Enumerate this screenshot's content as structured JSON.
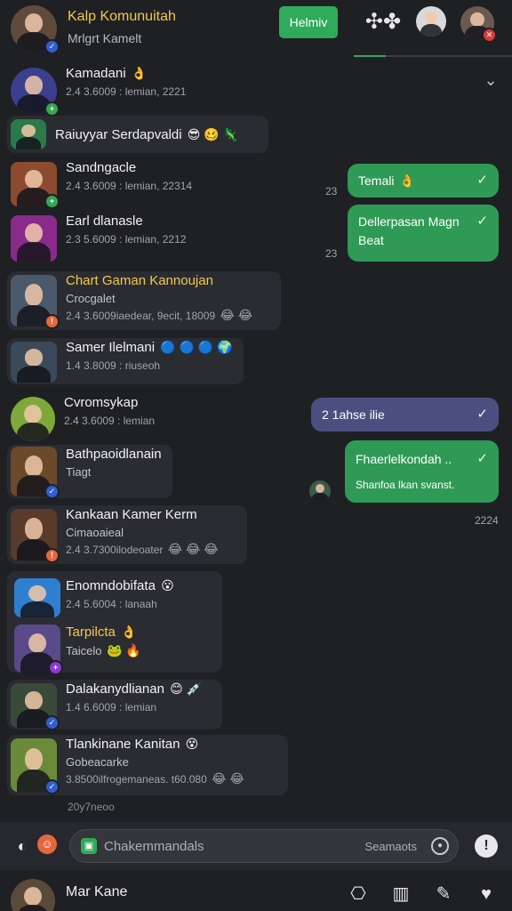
{
  "header": {
    "title": "Kalp Komunuitah",
    "subtitle": "Mrlgrt Kamelt",
    "follow_label": "Helmiv"
  },
  "chats": [
    {
      "name": "Kamadani",
      "emoji": "👌",
      "meta": "2.4 3.6009 : lemian, 2221"
    },
    {
      "name": "Raiuyyar Serdapvaldi",
      "emoji": "😎 🥴 🦎",
      "meta": ""
    },
    {
      "name": "Sandngacle",
      "emoji": "",
      "meta": "2.4 3.6009 : lemian, 22314"
    },
    {
      "name": "Earl dlanasle",
      "emoji": "",
      "meta": "2.3 5.6009 : lemian, 2212"
    },
    {
      "name": "Chart Gaman Kannoujan",
      "emoji": "",
      "meta2": "Crocgalet",
      "meta": "2.4 3.6009iaedear, 9ecit, 18009",
      "meta_emoji": "😂 😂"
    },
    {
      "name": "Samer Ilelmani",
      "emoji": "🔵 🔵 🔵 🌍",
      "meta": "1.4 3.8009 : riuseoh"
    },
    {
      "name": "Cvromsykap",
      "emoji": "",
      "meta": "2.4 3.6009 : lemian"
    },
    {
      "name": "Bathpaoidlanain",
      "emoji": "",
      "meta2": "Tiagt",
      "meta": ""
    },
    {
      "name": "Kankaan Kamer Kerm",
      "emoji": "",
      "meta2": "Cimaoaieal",
      "meta": "2.4 3.7300ilodeoater",
      "meta_emoji": "😂 😂 😂"
    },
    {
      "name": "Enomndobifata",
      "emoji": "😮",
      "meta": "2.4 5.6004 : lanaah"
    },
    {
      "name": "Tarpilcta",
      "emoji": "👌",
      "meta2": "Taicelo",
      "meta_emoji": "🐸 🔥",
      "meta": ""
    },
    {
      "name": "Dalakanydlianan",
      "emoji": "😊 💉",
      "meta": "1.4 6.6009 : lemian"
    },
    {
      "name": "Tlankinane Kanitan",
      "emoji": "😵",
      "meta2": "Gobeacarke",
      "meta": "3.8500ilfrogemaneas. t60.080",
      "meta_emoji": "😂 😂"
    }
  ],
  "footnote": "20y7neoo",
  "messages": [
    {
      "text": "Temali",
      "emoji": "👌",
      "time": "23"
    },
    {
      "text": "Dellerpasan Magn",
      "text2": "Beat",
      "time": "23"
    },
    {
      "text": "2 1ahse ilie",
      "time": ""
    },
    {
      "text": "Fhaerlelkondah ..",
      "text2": "Shanfoa lkan svanst.",
      "time": "2224"
    }
  ],
  "input": {
    "placeholder": "Chakemmandals",
    "send_label": "Seamaots"
  },
  "bottom": {
    "username": "Mar Kane"
  },
  "colors": {
    "background": "#1f2024",
    "accent": "#2faa5a",
    "bubble_green": "#2f9a55",
    "bubble_purple": "#4b4f80",
    "highlight_name": "#f2c94c"
  },
  "icons": [
    "chevron-down-icon",
    "gamepad-icon",
    "check-icon",
    "sticker-icon",
    "emoji-icon",
    "camera-icon",
    "microphone-icon",
    "gift-icon",
    "book-icon",
    "pen-icon",
    "heart-icon"
  ]
}
